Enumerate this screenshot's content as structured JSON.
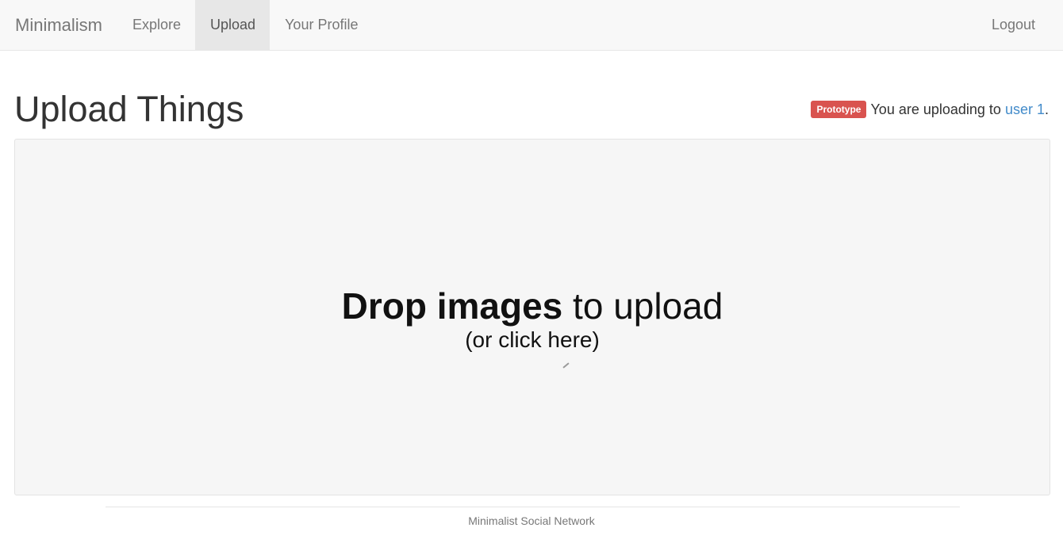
{
  "navbar": {
    "brand": "Minimalism",
    "items": [
      {
        "label": "Explore",
        "active": false
      },
      {
        "label": "Upload",
        "active": true
      },
      {
        "label": "Your Profile",
        "active": false
      }
    ],
    "logout": "Logout"
  },
  "header": {
    "title": "Upload Things",
    "badge": "Prototype",
    "info_prefix": "You are uploading to",
    "user_link": "user 1",
    "info_suffix": "."
  },
  "dropzone": {
    "main_strong": "Drop images",
    "main_rest": " to upload",
    "sub": "(or click here)"
  },
  "footer": {
    "text": "Minimalist Social Network"
  },
  "colors": {
    "navbar_bg": "#f8f8f8",
    "badge_bg": "#d9534f",
    "link": "#428bca",
    "dropzone_bg": "#f6f6f6"
  }
}
